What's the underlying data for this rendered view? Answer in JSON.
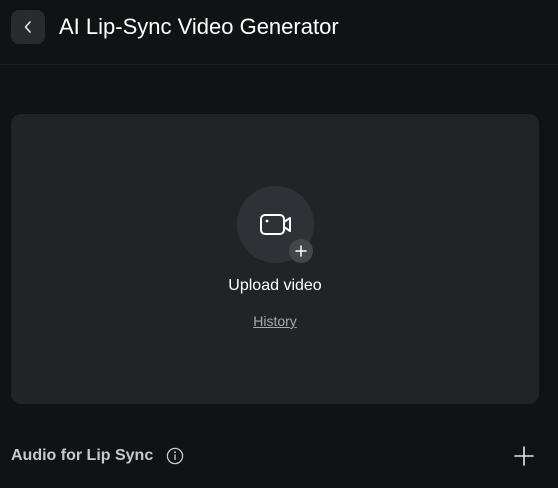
{
  "header": {
    "title": "AI Lip-Sync Video Generator",
    "back_icon": "chevron-left-icon"
  },
  "upload": {
    "label": "Upload video",
    "history_label": "History",
    "camera_icon": "video-camera-icon",
    "plus_icon": "plus-icon"
  },
  "audio": {
    "section_title": "Audio for Lip Sync",
    "info_icon": "info-icon",
    "add_icon": "plus-icon"
  },
  "colors": {
    "background": "#111214",
    "card": "#222327",
    "text_primary": "#ffffff",
    "text_muted": "#a8a9ae"
  }
}
